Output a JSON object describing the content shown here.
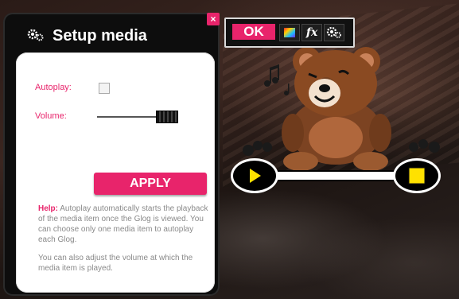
{
  "panel": {
    "title": "Setup media",
    "close_label": "×",
    "autoplay_label": "Autoplay:",
    "autoplay_checked": false,
    "volume_label": "Volume:",
    "volume_level": 1.0,
    "apply_label": "APPLY",
    "help_strong": "Help:",
    "help_text": "Autoplay automatically starts the playback of the media item once the Glog is viewed. You can choose only one media item to autoplay each Glog.",
    "help_text2": "You can also adjust the volume at which the media item is played."
  },
  "toolbar": {
    "ok_label": "OK",
    "fx_label": "fx",
    "icons": [
      "color-palette-icon",
      "fx-icon",
      "gear-icon"
    ]
  },
  "player": {
    "play_icon": "play-icon",
    "stop_icon": "stop-icon"
  },
  "colors": {
    "accent": "#e8246b",
    "control_yellow": "#ffe100"
  }
}
